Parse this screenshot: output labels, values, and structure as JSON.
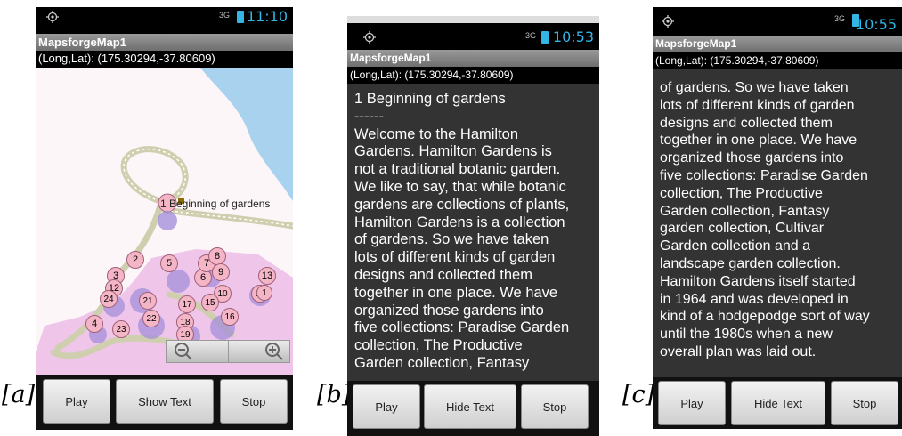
{
  "figure_labels": [
    "[a]",
    "[b]",
    "[c]"
  ],
  "app_title": "MapsforgeMap1",
  "coords_text": "(Long,Lat): (175.30294,-37.80609)",
  "network_label": "3G",
  "screens": [
    {
      "time": "11:10",
      "toggle_label": "Show Text"
    },
    {
      "time": "10:53",
      "toggle_label": "Hide Text"
    },
    {
      "time": "10:55",
      "toggle_label": "Hide Text"
    }
  ],
  "buttons": {
    "play": "Play",
    "stop": "Stop"
  },
  "map": {
    "poi_label": "1 Beginning of gardens",
    "markers": [
      "1",
      "2",
      "3",
      "4",
      "5",
      "6",
      "7",
      "8",
      "9",
      "10",
      "12",
      "13",
      "14",
      "15",
      "16",
      "17",
      "18",
      "19",
      "21",
      "22",
      "23",
      "24"
    ]
  },
  "story_b": "1 Beginning of gardens\n------\nWelcome to the Hamilton\nGardens. Hamilton Gardens is\nnot a traditional botanic garden.\nWe like to say, that while botanic\ngardens are collections of plants,\nHamilton Gardens is a collection\nof gardens. So we have taken\nlots of different kinds of garden\ndesigns and collected them\ntogether in one place. We have\norganized those gardens into\nfive collections: Paradise Garden\ncollection, The Productive\nGarden collection, Fantasy",
  "story_c": "of gardens. So we have taken\nlots of different kinds of garden\ndesigns and collected them\ntogether in one place. We have\norganized those gardens into\nfive collections: Paradise Garden\ncollection, The Productive\nGarden collection, Fantasy\ngarden collection, Cultivar\nGarden collection and a\nlandscape garden collection.\nHamilton Gardens itself started\nin 1964 and was developed in\nkind of a hodgepodge sort of way\nuntil the 1980s when a new\noverall plan was laid out."
}
